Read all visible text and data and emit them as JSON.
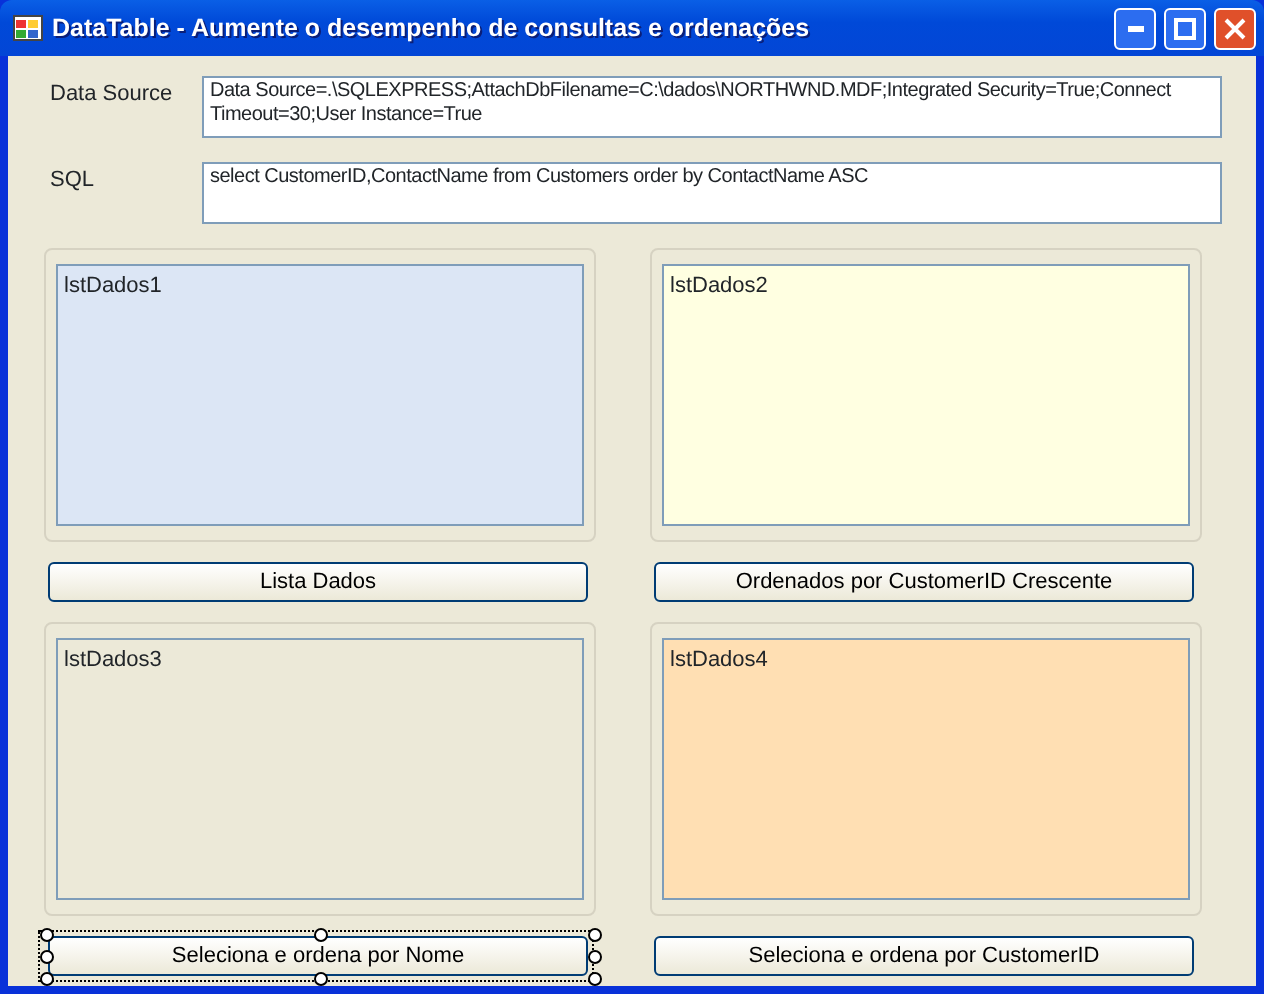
{
  "window": {
    "title": "DataTable - Aumente o desempenho de consultas e ordenações"
  },
  "fields": [
    {
      "label": "Data Source",
      "value": "Data Source=.\\SQLEXPRESS;AttachDbFilename=C:\\dados\\NORTHWND.MDF;Integrated Security=True;Connect Timeout=30;User Instance=True"
    },
    {
      "label": "SQL",
      "value": "select CustomerID,ContactName from Customers order by ContactName ASC"
    }
  ],
  "panels": [
    {
      "list": "lstDados1",
      "color": "#dce6f5",
      "button": "Lista Dados",
      "selected": false
    },
    {
      "list": "lstDados2",
      "color": "#ffffe1",
      "button": "Ordenados por CustomerID Crescente",
      "selected": false
    },
    {
      "list": "lstDados3",
      "color": "#ece9d8",
      "button": "Seleciona e ordena por Nome",
      "selected": true
    },
    {
      "list": "lstDados4",
      "color": "#ffdfb3",
      "button": "Seleciona e ordena por CustomerID",
      "selected": false
    }
  ]
}
